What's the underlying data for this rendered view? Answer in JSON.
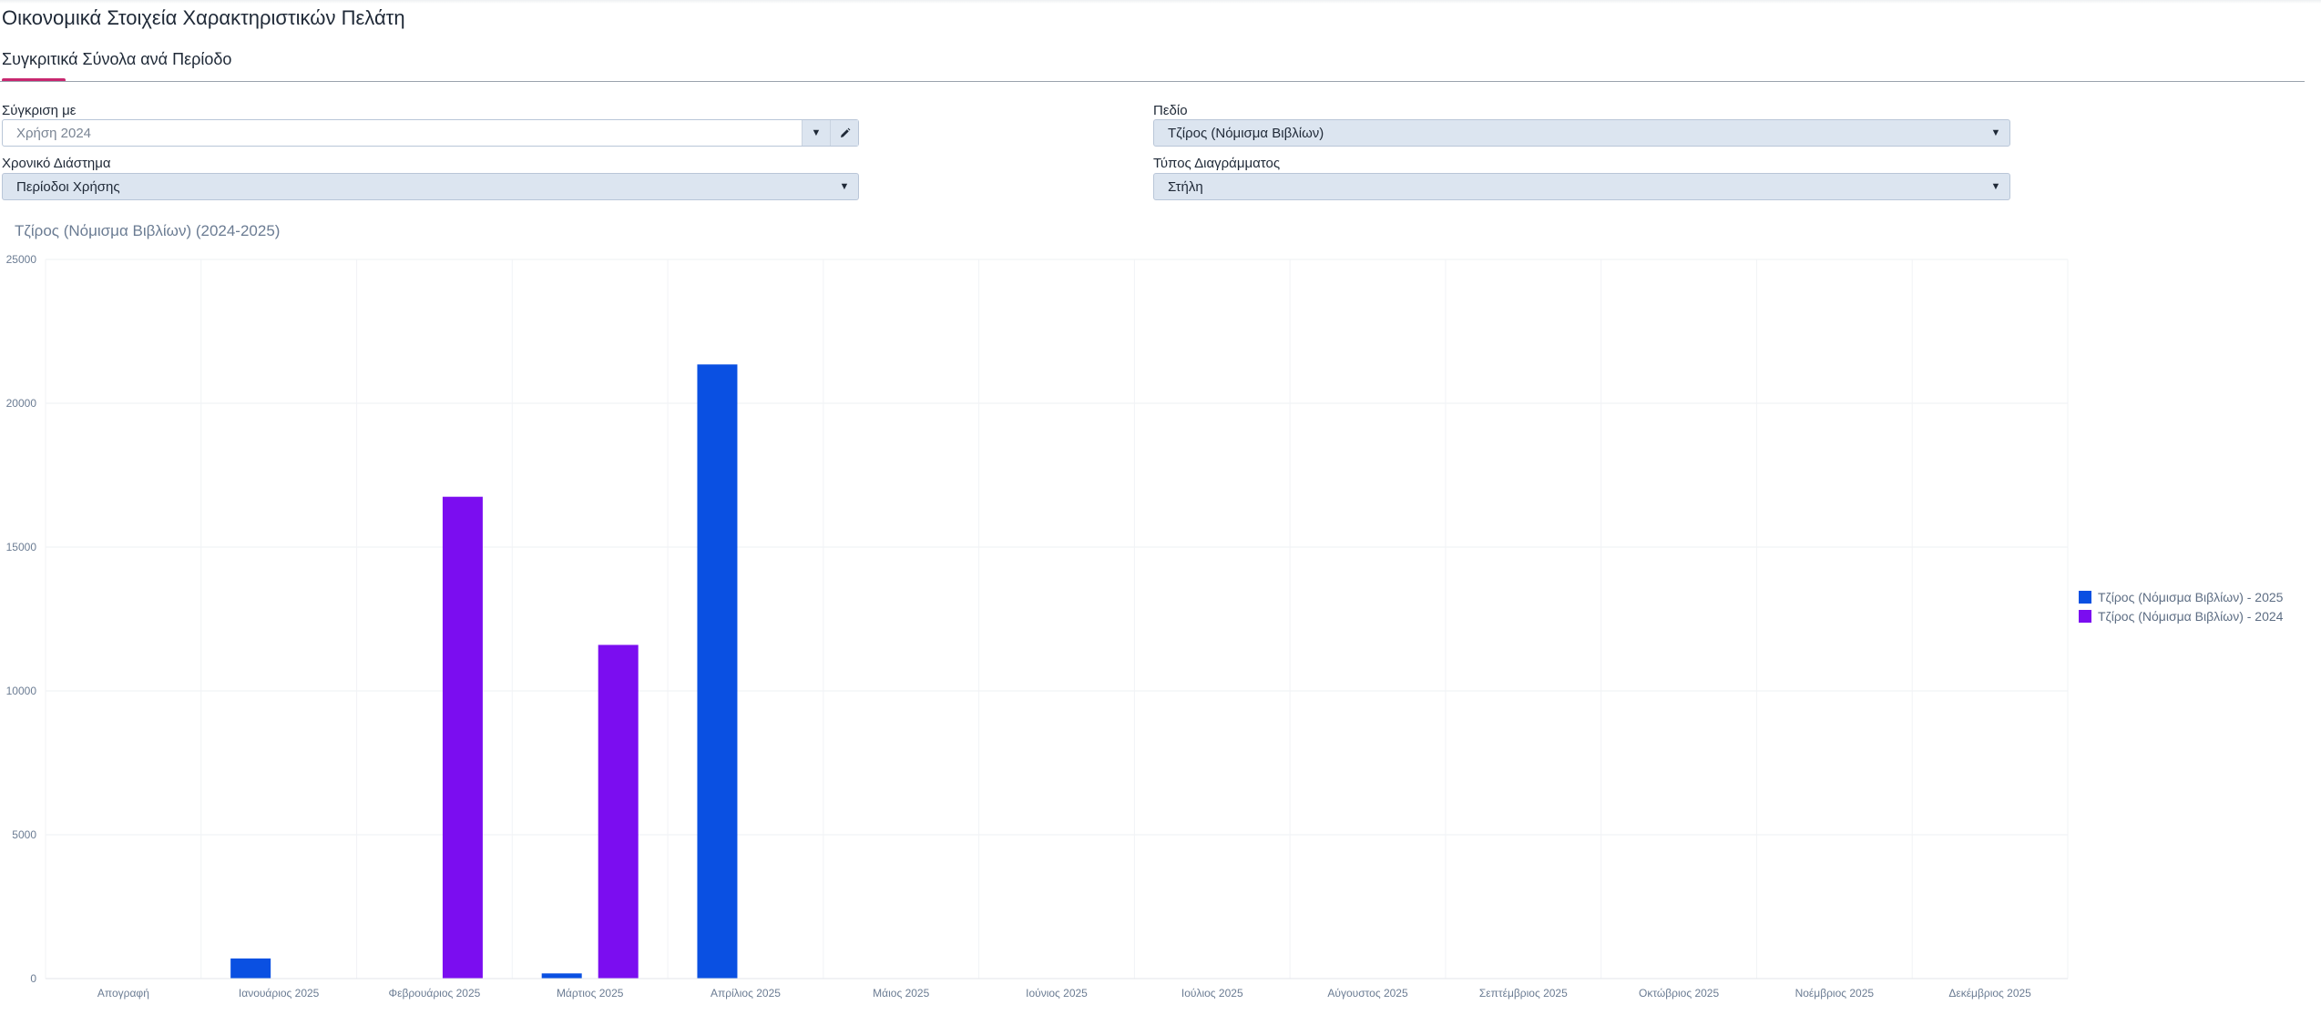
{
  "header": {
    "title": "Οικονομικά Στοιχεία Χαρακτηριστικών Πελάτη",
    "tab_label": "Συγκριτικά Σύνολα ανά Περίοδο"
  },
  "filters": {
    "compare_label": "Σύγκριση με",
    "compare_placeholder": "Χρήση 2024",
    "period_label": "Χρονικό Διάστημα",
    "period_value": "Περίοδοι Χρήσης",
    "field_label": "Πεδίο",
    "field_value": "Τζίρος (Νόμισμα Βιβλίων)",
    "charttype_label": "Τύπος Διαγράμματος",
    "charttype_value": "Στήλη"
  },
  "icons": {
    "caret": "caret-down-icon",
    "edit": "pencil-icon"
  },
  "colors": {
    "accent": "#c8276f",
    "series_2025": "#0a50e2",
    "series_2024": "#7b0df0"
  },
  "chart_data": {
    "type": "bar",
    "title": "Τζίρος (Νόμισμα Βιβλίων) (2024-2025)",
    "categories": [
      "Απογραφή",
      "Ιανουάριος 2025",
      "Φεβρουάριος 2025",
      "Μάρτιος 2025",
      "Απρίλιος 2025",
      "Μάιος 2025",
      "Ιούνιος 2025",
      "Ιούλιος 2025",
      "Αύγουστος 2025",
      "Σεπτέμβριος 2025",
      "Οκτώβριος 2025",
      "Νοέμβριος 2025",
      "Δεκέμβριος 2025"
    ],
    "series": [
      {
        "name": "Τζίρος (Νόμισμα Βιβλίων) - 2025",
        "color": "#0a50e2",
        "values": [
          0,
          700,
          0,
          180,
          21350,
          0,
          0,
          0,
          0,
          0,
          0,
          0,
          0
        ]
      },
      {
        "name": "Τζίρος (Νόμισμα Βιβλίων) - 2024",
        "color": "#7b0df0",
        "values": [
          0,
          0,
          16750,
          11600,
          0,
          0,
          0,
          0,
          0,
          0,
          0,
          0,
          0
        ]
      }
    ],
    "ylim": [
      0,
      25000
    ],
    "yticks": [
      "0",
      "5000",
      "10000",
      "15000",
      "20000",
      "25000"
    ],
    "grid": true,
    "legend_position": "right"
  }
}
